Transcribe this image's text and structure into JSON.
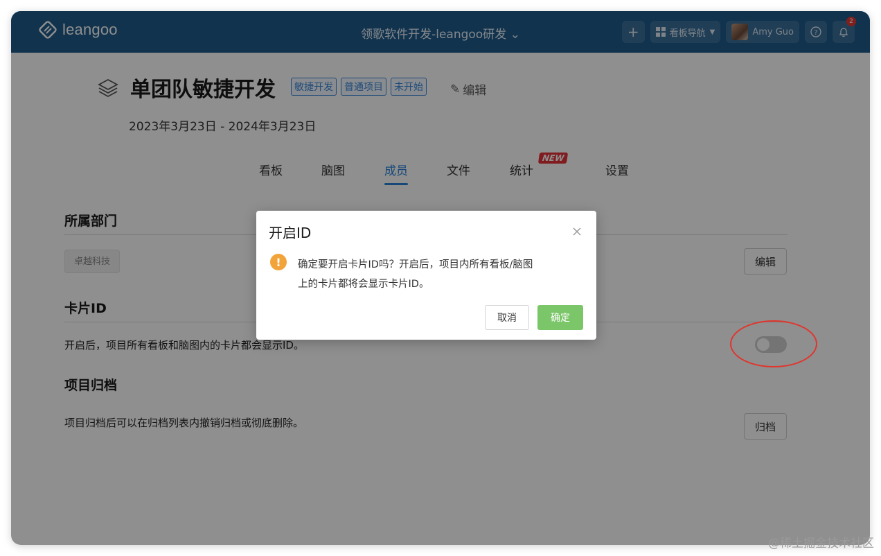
{
  "topbar": {
    "logo_text": "leangoo",
    "project_switch": "领歌软件开发-leangoo研发",
    "board_nav_label": "看板导航",
    "user_name": "Amy Guo",
    "notification_count": "2"
  },
  "project": {
    "title": "单团队敏捷开发",
    "tags": [
      "敏捷开发",
      "普通项目",
      "未开始"
    ],
    "edit_label": "编辑",
    "date_range": "2023年3月23日 - 2024年3月23日"
  },
  "tabs": [
    {
      "label": "看板"
    },
    {
      "label": "脑图"
    },
    {
      "label": "成员"
    },
    {
      "label": "文件"
    },
    {
      "label": "统计"
    },
    {
      "label": "设置"
    }
  ],
  "tab_new_badge": "NEW",
  "sections": {
    "department": {
      "title": "所属部门",
      "chip": "卓越科技",
      "edit_button": "编辑"
    },
    "card_id": {
      "title": "卡片ID",
      "description": "开启后，项目所有看板和脑图内的卡片都会显示ID。",
      "toggle_on": false
    },
    "archive": {
      "title": "项目归档",
      "description": "项目归档后可以在归档列表内撤销归档或彻底删除。",
      "button": "归档"
    }
  },
  "dialog": {
    "title": "开启ID",
    "message_line1": "确定要开启卡片ID吗？开启后，项目内所有看板/脑图",
    "message_line2": "上的卡片都将会显示卡片ID。",
    "cancel": "取消",
    "confirm": "确定"
  },
  "watermark": "@稀土掘金技术社区",
  "colors": {
    "topbar": "#1f5c8c",
    "accent": "#2a82d6",
    "confirm": "#7cc66a",
    "warning": "#f2a33a",
    "annotation": "#e0352c"
  }
}
